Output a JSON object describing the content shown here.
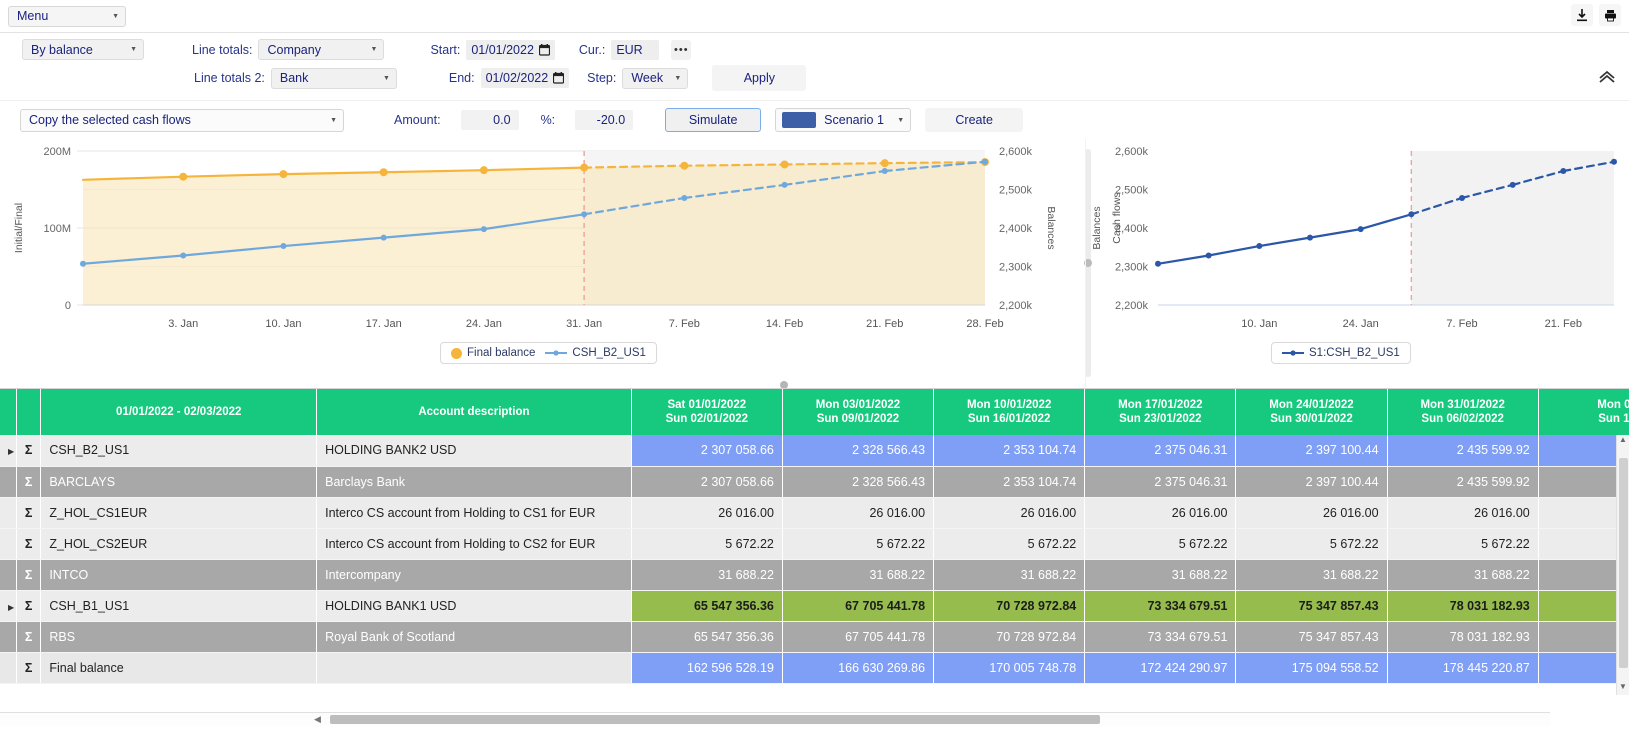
{
  "menubar": {
    "menu_label": "Menu",
    "download_icon": "download-icon",
    "print_icon": "print-icon"
  },
  "filters": {
    "view_mode": "By balance",
    "line_totals_label": "Line totals:",
    "line_totals_value": "Company",
    "line_totals2_label": "Line totals 2:",
    "line_totals2_value": "Bank",
    "start_label": "Start:",
    "start_value": "01/01/2022",
    "end_label": "End:",
    "end_value": "01/02/2022",
    "cur_label": "Cur.:",
    "cur_value": "EUR",
    "cur_more": "•••",
    "step_label": "Step:",
    "step_value": "Week",
    "apply_label": "Apply",
    "collapse_icon": "chevron-up-icon"
  },
  "actions": {
    "operation": "Copy the selected cash flows",
    "amount_label": "Amount:",
    "amount_value": "0.0",
    "percent_label": "%:",
    "percent_value": "-20.0",
    "simulate_label": "Simulate",
    "scenario_label": "Scenario 1",
    "scenario_color": "#3d5fa8",
    "create_label": "Create"
  },
  "chart_data": [
    {
      "type": "line",
      "name": "main-chart",
      "title": "",
      "ylabel": "Initial/Final",
      "y2label": "Balances",
      "ylim": [
        0,
        200000000
      ],
      "yticks": [
        "0",
        "100M",
        "200M"
      ],
      "y2lim": [
        2200000,
        2600000
      ],
      "y2ticks": [
        "2,200k",
        "2,300k",
        "2,400k",
        "2,500k",
        "2,600k"
      ],
      "xticks": [
        "3. Jan",
        "10. Jan",
        "17. Jan",
        "24. Jan",
        "31. Jan",
        "7. Feb",
        "14. Feb",
        "21. Feb",
        "28. Feb"
      ],
      "forecast_start": "31. Jan",
      "legend": [
        "Final balance",
        "CSH_B2_US1"
      ],
      "legend_position": "bottom",
      "series": [
        {
          "name": "Final balance",
          "color": "#f5b53c",
          "axis": "left",
          "x": [
            "1. Jan",
            "3. Jan",
            "10. Jan",
            "17. Jan",
            "24. Jan",
            "31. Jan",
            "7. Feb",
            "14. Feb",
            "21. Feb",
            "28. Feb"
          ],
          "values": [
            162596528,
            166630270,
            170005749,
            172424291,
            175094559,
            178445221,
            180900000,
            182500000,
            184200000,
            185600000
          ]
        },
        {
          "name": "CSH_B2_US1",
          "color": "#6fa8dc",
          "axis": "right",
          "x": [
            "1. Jan",
            "3. Jan",
            "10. Jan",
            "17. Jan",
            "24. Jan",
            "31. Jan",
            "7. Feb",
            "14. Feb",
            "21. Feb",
            "28. Feb"
          ],
          "values": [
            2307059,
            2328566,
            2353105,
            2375046,
            2397100,
            2435600,
            2478000,
            2512000,
            2548000,
            2572000
          ]
        }
      ]
    },
    {
      "type": "line",
      "name": "scenario-chart",
      "title": "",
      "ylabel": "Balances",
      "y2label": "Cash flows",
      "ylim": [
        2200000,
        2600000
      ],
      "yticks": [
        "2,200k",
        "2,300k",
        "2,400k",
        "2,500k",
        "2,600k"
      ],
      "xticks": [
        "10. Jan",
        "24. Jan",
        "7. Feb",
        "21. Feb"
      ],
      "forecast_start": "31. Jan",
      "legend": [
        "S1:CSH_B2_US1"
      ],
      "legend_position": "bottom",
      "series": [
        {
          "name": "S1:CSH_B2_US1",
          "color": "#2b57a8",
          "axis": "left",
          "x": [
            "1. Jan",
            "3. Jan",
            "10. Jan",
            "17. Jan",
            "24. Jan",
            "31. Jan",
            "7. Feb",
            "14. Feb",
            "21. Feb",
            "28. Feb"
          ],
          "values": [
            2307059,
            2328566,
            2353105,
            2375046,
            2397100,
            2435600,
            2478000,
            2512000,
            2548000,
            2572000
          ]
        }
      ]
    }
  ],
  "table": {
    "headers": {
      "period": "01/01/2022 - 02/03/2022",
      "description": "Account description",
      "dates": [
        {
          "top": "Sat 01/01/2022",
          "bottom": "Sun 02/01/2022"
        },
        {
          "top": "Mon 03/01/2022",
          "bottom": "Sun 09/01/2022"
        },
        {
          "top": "Mon 10/01/2022",
          "bottom": "Sun 16/01/2022"
        },
        {
          "top": "Mon 17/01/2022",
          "bottom": "Sun 23/01/2022"
        },
        {
          "top": "Mon 24/01/2022",
          "bottom": "Sun 30/01/2022"
        },
        {
          "top": "Mon 31/01/2022",
          "bottom": "Sun 06/02/2022"
        },
        {
          "top": "Mon 0",
          "bottom": "Sun 1"
        }
      ]
    },
    "rows": [
      {
        "expandable": true,
        "style": "light",
        "highlight": "blue",
        "code": "CSH_B2_US1",
        "description": "HOLDING BANK2 USD",
        "values": [
          "2 307 058.66",
          "2 328 566.43",
          "2 353 104.74",
          "2 375 046.31",
          "2 397 100.44",
          "2 435 599.92",
          ""
        ]
      },
      {
        "expandable": false,
        "style": "dark",
        "highlight": "none",
        "code": "BARCLAYS",
        "description": "Barclays Bank",
        "values": [
          "2 307 058.66",
          "2 328 566.43",
          "2 353 104.74",
          "2 375 046.31",
          "2 397 100.44",
          "2 435 599.92",
          ""
        ]
      },
      {
        "expandable": false,
        "style": "light",
        "highlight": "none",
        "code": "Z_HOL_CS1EUR",
        "description": "Interco CS account from Holding to CS1 for EUR",
        "values": [
          "26 016.00",
          "26 016.00",
          "26 016.00",
          "26 016.00",
          "26 016.00",
          "26 016.00",
          ""
        ]
      },
      {
        "expandable": false,
        "style": "light",
        "highlight": "none",
        "code": "Z_HOL_CS2EUR",
        "description": "Interco CS account from Holding to CS2 for EUR",
        "values": [
          "5 672.22",
          "5 672.22",
          "5 672.22",
          "5 672.22",
          "5 672.22",
          "5 672.22",
          ""
        ]
      },
      {
        "expandable": false,
        "style": "dark",
        "highlight": "none",
        "code": "INTCO",
        "description": "Intercompany",
        "values": [
          "31 688.22",
          "31 688.22",
          "31 688.22",
          "31 688.22",
          "31 688.22",
          "31 688.22",
          ""
        ]
      },
      {
        "expandable": true,
        "style": "light",
        "highlight": "green",
        "code": "CSH_B1_US1",
        "description": "HOLDING BANK1 USD",
        "values": [
          "65 547 356.36",
          "67 705 441.78",
          "70 728 972.84",
          "73 334 679.51",
          "75 347 857.43",
          "78 031 182.93",
          ""
        ]
      },
      {
        "expandable": false,
        "style": "dark",
        "highlight": "none",
        "code": "RBS",
        "description": "Royal Bank of Scotland",
        "values": [
          "65 547 356.36",
          "67 705 441.78",
          "70 728 972.84",
          "73 334 679.51",
          "75 347 857.43",
          "78 031 182.93",
          ""
        ]
      },
      {
        "expandable": false,
        "style": "final",
        "highlight": "blue",
        "code": "Final balance",
        "description": "",
        "values": [
          "162 596 528.19",
          "166 630 269.86",
          "170 005 748.78",
          "172 424 290.97",
          "175 094 558.52",
          "178 445 220.87",
          ""
        ]
      }
    ],
    "sigma_symbol": "Σ",
    "expand_symbol": "▶"
  }
}
